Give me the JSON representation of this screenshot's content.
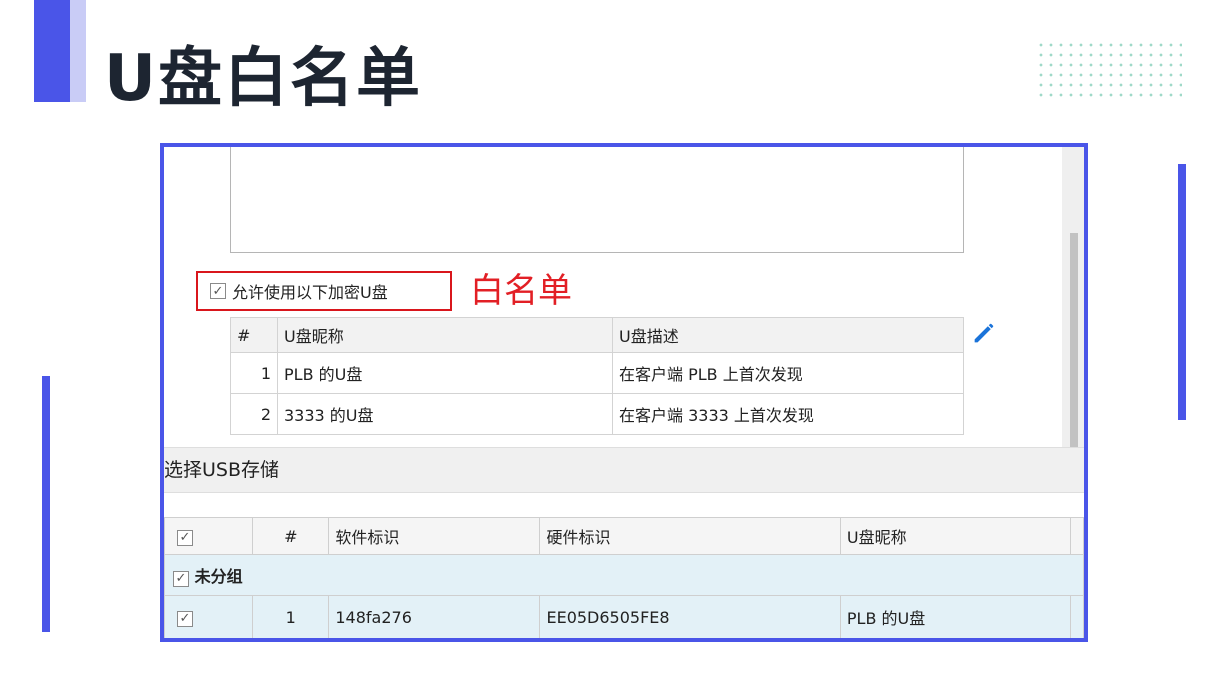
{
  "slide": {
    "title": "U盘白名单",
    "accent_color": "#4a55e8"
  },
  "top_section": {
    "allow_checkbox": {
      "checked": true,
      "label": "允许使用以下加密U盘"
    },
    "annotation": "白名单",
    "whitelist_table": {
      "columns": [
        "#",
        "U盘昵称",
        "U盘描述"
      ],
      "rows": [
        {
          "index": "1",
          "nickname": "PLB 的U盘",
          "description": "在客户端 PLB 上首次发现"
        },
        {
          "index": "2",
          "nickname": "3333 的U盘",
          "description": "在客户端 3333 上首次发现"
        }
      ]
    },
    "edit_icon": "pencil-icon"
  },
  "usb_section": {
    "title": "选择USB存储",
    "table": {
      "columns": [
        "",
        "#",
        "软件标识",
        "硬件标识",
        "U盘昵称"
      ],
      "group": {
        "label": "未分组",
        "checked": true
      },
      "rows": [
        {
          "checked": true,
          "index": "1",
          "software_id": "148fa276",
          "hardware_id": "EE05D6505FE8",
          "nickname": "PLB 的U盘"
        }
      ]
    }
  }
}
